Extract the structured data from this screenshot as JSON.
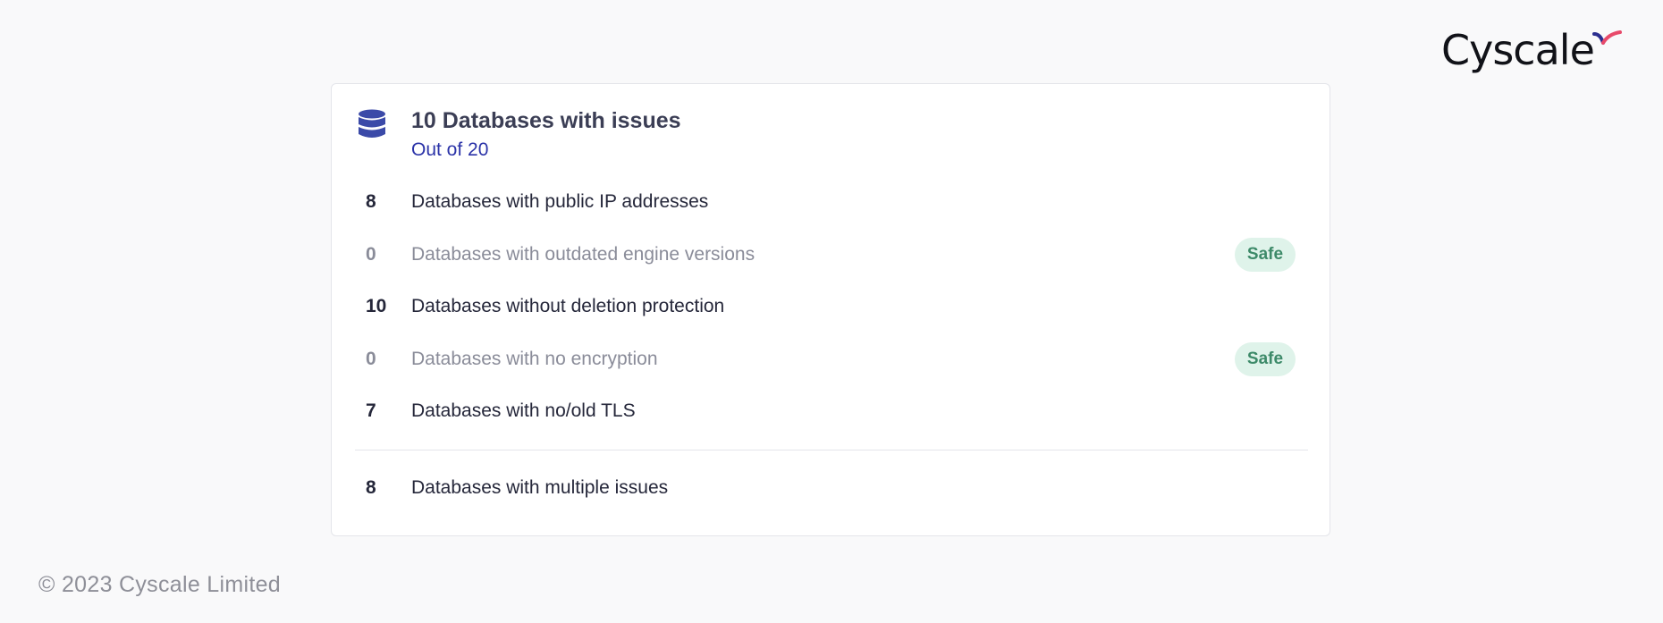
{
  "brand": {
    "name": "Cyscale",
    "accent_colors": [
      "#2b2f8f",
      "#e84a6a"
    ]
  },
  "card": {
    "icon": "database-icon",
    "title": "10 Databases with issues",
    "subtitle": "Out of 20",
    "rows": [
      {
        "count": "8",
        "label": "Databases with public IP addresses",
        "status": ""
      },
      {
        "count": "0",
        "label": "Databases with outdated engine versions",
        "status": "Safe"
      },
      {
        "count": "10",
        "label": "Databases without deletion protection",
        "status": ""
      },
      {
        "count": "0",
        "label": "Databases with no encryption",
        "status": "Safe"
      },
      {
        "count": "7",
        "label": "Databases with no/old TLS",
        "status": ""
      }
    ],
    "summary": {
      "count": "8",
      "label": "Databases with multiple issues"
    }
  },
  "footer": {
    "copyright": "© 2023 Cyscale Limited"
  },
  "colors": {
    "title": "#3b3e55",
    "subtitle": "#2b33a8",
    "icon": "#3b4aa8",
    "safe_badge_bg": "#dff3ea",
    "safe_badge_text": "#3d8a69",
    "muted_text": "#8a8c99"
  }
}
